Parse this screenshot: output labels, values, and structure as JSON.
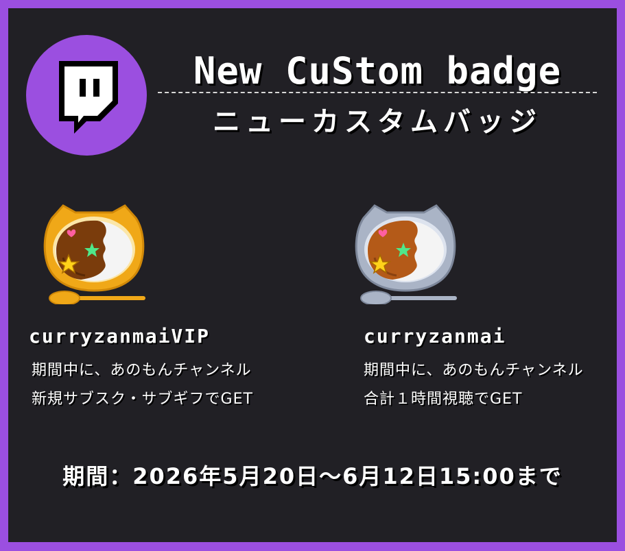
{
  "title": {
    "english": "New CuStom badge",
    "japanese": "ニューカスタムバッジ"
  },
  "logo": {
    "icon": "twitch-icon"
  },
  "badges": [
    {
      "name": "curryzanmaiVIP",
      "line1": "期間中に、あのもんチャンネル",
      "line2": "新規サブスク・サブギフでGET",
      "style": "gold",
      "icon": "curry-badge-gold-icon"
    },
    {
      "name": "curryzanmai",
      "line1": "期間中に、あのもんチャンネル",
      "line2": "合計１時間視聴でGET",
      "style": "silver",
      "icon": "curry-badge-silver-icon"
    }
  ],
  "period": "期間：2026年5月20日～6月12日15:00まで",
  "colors": {
    "frame": "#9b4fe0",
    "background": "#212025",
    "text": "#ffffff"
  }
}
